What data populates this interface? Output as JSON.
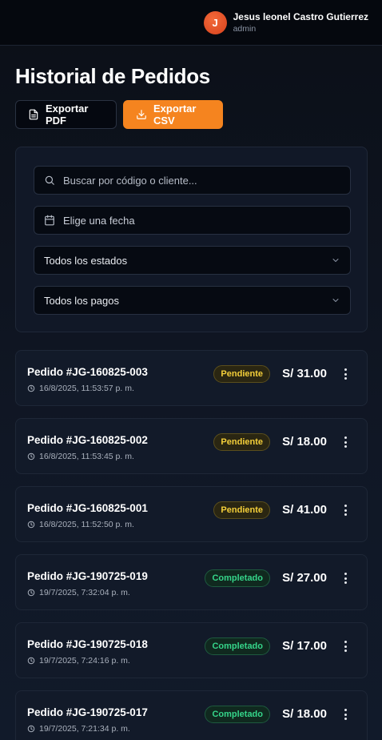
{
  "header": {
    "avatar_initial": "J",
    "user_name": "Jesus leonel Castro Gutierrez",
    "user_role": "admin"
  },
  "page": {
    "title": "Historial de Pedidos",
    "export_pdf_label": "Exportar PDF",
    "export_csv_label": "Exportar CSV"
  },
  "filters": {
    "search_placeholder": "Buscar por código o cliente...",
    "date_placeholder": "Elige una fecha",
    "status_select": "Todos los estados",
    "payment_select": "Todos los pagos"
  },
  "colors": {
    "accent": "#f5841f",
    "pending": "#f4cf3a",
    "completed": "#35d58a",
    "background": "#0d111a"
  },
  "orders": [
    {
      "code": "Pedido #JG-160825-003",
      "datetime": "16/8/2025, 11:53:57 p. m.",
      "status": "Pendiente",
      "amount": "S/ 31.00"
    },
    {
      "code": "Pedido #JG-160825-002",
      "datetime": "16/8/2025, 11:53:45 p. m.",
      "status": "Pendiente",
      "amount": "S/ 18.00"
    },
    {
      "code": "Pedido #JG-160825-001",
      "datetime": "16/8/2025, 11:52:50 p. m.",
      "status": "Pendiente",
      "amount": "S/ 41.00"
    },
    {
      "code": "Pedido #JG-190725-019",
      "datetime": "19/7/2025, 7:32:04 p. m.",
      "status": "Completado",
      "amount": "S/ 27.00"
    },
    {
      "code": "Pedido #JG-190725-018",
      "datetime": "19/7/2025, 7:24:16 p. m.",
      "status": "Completado",
      "amount": "S/ 17.00"
    },
    {
      "code": "Pedido #JG-190725-017",
      "datetime": "19/7/2025, 7:21:34 p. m.",
      "status": "Completado",
      "amount": "S/ 18.00"
    }
  ]
}
